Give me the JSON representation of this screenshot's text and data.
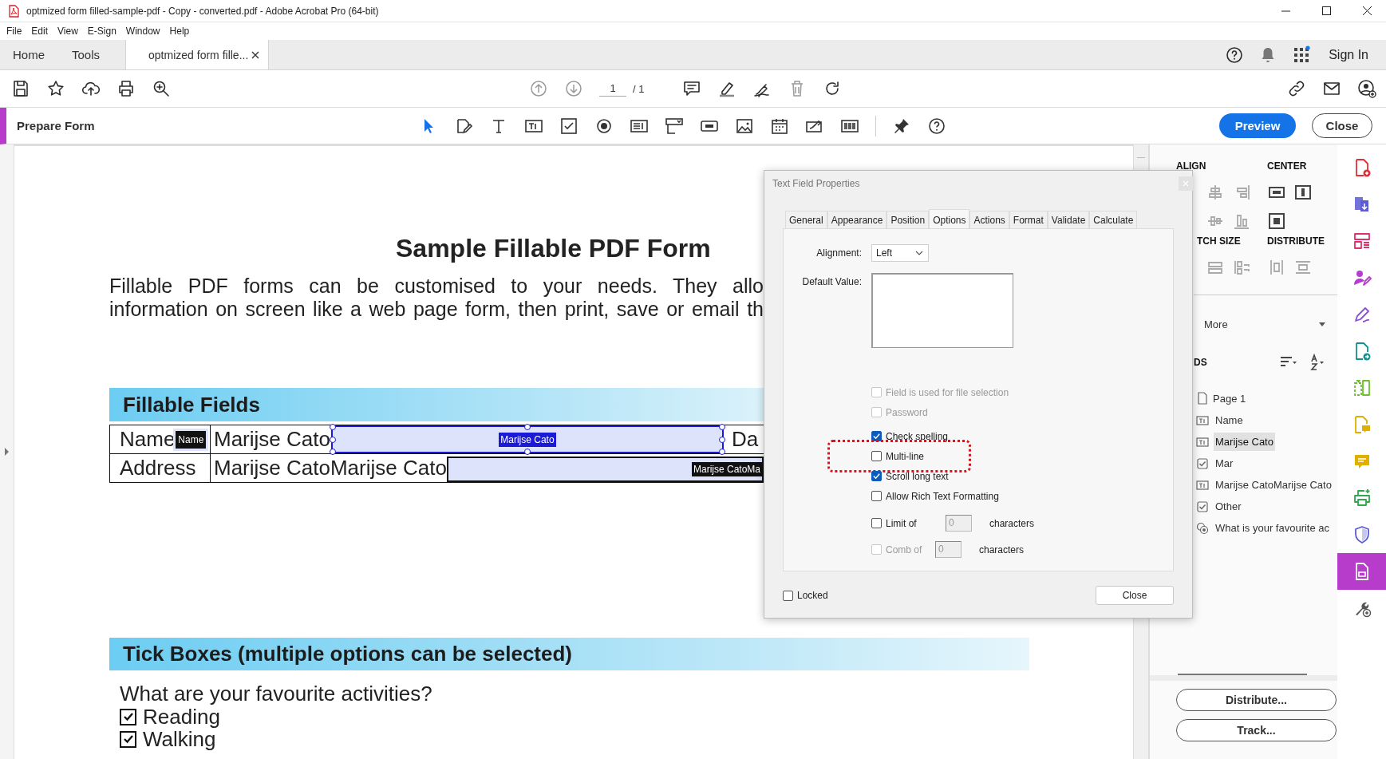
{
  "window": {
    "title": "optmized form filled-sample-pdf - Copy - converted.pdf - Adobe Acrobat Pro (64-bit)"
  },
  "menu": [
    "File",
    "Edit",
    "View",
    "E-Sign",
    "Window",
    "Help"
  ],
  "app_tabs": [
    {
      "label": "Home",
      "selected": false,
      "kind": "home"
    },
    {
      "label": "Tools",
      "selected": false,
      "kind": "home"
    },
    {
      "label": "optmized form fille...",
      "selected": true,
      "kind": "document"
    }
  ],
  "sign_in": "Sign In",
  "page_nav": {
    "current": "1",
    "total": "/ 1"
  },
  "prepare_form": {
    "title": "Prepare Form",
    "preview": "Preview",
    "close": "Close",
    "tools": [
      {
        "kind": "pointer",
        "selected": true
      },
      {
        "kind": "edit",
        "selected": false
      },
      {
        "kind": "text",
        "selected": false
      },
      {
        "kind": "text-field",
        "selected": false
      },
      {
        "kind": "checkbox",
        "selected": false
      },
      {
        "kind": "radio",
        "selected": false
      },
      {
        "kind": "list-box",
        "selected": false
      },
      {
        "kind": "dropdown",
        "selected": false
      },
      {
        "kind": "button",
        "selected": false
      },
      {
        "kind": "image",
        "selected": false
      },
      {
        "kind": "date",
        "selected": false
      },
      {
        "kind": "signature",
        "selected": false
      },
      {
        "kind": "barcode",
        "selected": false
      },
      {
        "kind": "pin",
        "selected": false
      },
      {
        "kind": "help",
        "selected": false
      }
    ]
  },
  "document": {
    "title": "Sample Fillable PDF Form",
    "intro": [
      "Fillable PDF forms can be customised to your needs. They allo",
      "information on screen like a web page form, then print, save or email th"
    ],
    "fillable": {
      "heading": "Fillable Fields",
      "rows": [
        {
          "label": "Name",
          "tag": "Name",
          "value": "Marijse Cato",
          "field_label": "Marijse Cato",
          "selected": true,
          "next": "Da"
        },
        {
          "label": "Address",
          "value": "Marijse CatoMarijse Cato",
          "field_label": "Marijse CatoMa",
          "selected": false
        }
      ]
    },
    "tick_boxes": {
      "heading": "Tick Boxes (multiple options can be selected)",
      "question": "What are your favourite activities?",
      "options": [
        {
          "label": "Reading",
          "checked": true
        },
        {
          "label": "Walking",
          "checked": true
        }
      ]
    }
  },
  "dialog": {
    "title": "Text Field Properties",
    "tabs": [
      {
        "label": "General",
        "selected": false
      },
      {
        "label": "Appearance",
        "selected": false
      },
      {
        "label": "Position",
        "selected": false
      },
      {
        "label": "Options",
        "selected": true
      },
      {
        "label": "Actions",
        "selected": false
      },
      {
        "label": "Format",
        "selected": false
      },
      {
        "label": "Validate",
        "selected": false
      },
      {
        "label": "Calculate",
        "selected": false
      }
    ],
    "alignment": {
      "label": "Alignment:",
      "value": "Left"
    },
    "default_value": {
      "label": "Default Value:"
    },
    "options": [
      {
        "label": "Field is used for file selection",
        "checked": false,
        "disabled": true,
        "highlighted": false
      },
      {
        "label": "Password",
        "checked": false,
        "disabled": true,
        "highlighted": false
      },
      {
        "label": "Check spelling",
        "checked": true,
        "disabled": false,
        "highlighted": false
      },
      {
        "label": "Multi-line",
        "checked": false,
        "disabled": false,
        "highlighted": true
      },
      {
        "label": "Scroll long text",
        "checked": true,
        "disabled": false,
        "highlighted": false
      },
      {
        "label": "Allow Rich Text Formatting",
        "checked": false,
        "disabled": false,
        "highlighted": false
      }
    ],
    "limits": [
      {
        "label": "Limit of",
        "checked": false,
        "disabled": false,
        "value": "0",
        "unit": "characters"
      },
      {
        "label": "Comb of",
        "checked": false,
        "disabled": true,
        "value": "0",
        "unit": "characters"
      }
    ],
    "locked": {
      "label": "Locked",
      "checked": false
    },
    "close": "Close"
  },
  "fields_panel": {
    "align": "ALIGN",
    "center": "CENTER",
    "match_size": "TCH SIZE",
    "distribute": "DISTRIBUTE",
    "more": "More",
    "fields_heading": "DS",
    "tree": [
      {
        "label": "Page 1",
        "kind": "page",
        "selected": false,
        "children": [
          {
            "label": "Name",
            "kind": "text",
            "selected": false
          },
          {
            "label": "Marijse Cato",
            "kind": "text",
            "selected": true
          },
          {
            "label": "Mar",
            "kind": "checkbox",
            "selected": false
          },
          {
            "label": "Marijse CatoMarijse Cato",
            "kind": "text",
            "selected": false
          },
          {
            "label": "Other",
            "kind": "checkbox",
            "selected": false
          },
          {
            "label": "What is your favourite ac",
            "kind": "radio",
            "selected": false
          }
        ]
      }
    ],
    "buttons": [
      "Distribute...",
      "Track..."
    ]
  },
  "rail": [
    {
      "kind": "create-pdf",
      "color": "#e0303a",
      "selected": false
    },
    {
      "kind": "export",
      "color": "#5b5bd6",
      "selected": false
    },
    {
      "kind": "organize",
      "color": "#e0306b",
      "selected": false
    },
    {
      "kind": "request-sign",
      "color": "#b63dd0",
      "selected": false
    },
    {
      "kind": "fill-sign",
      "color": "#8a4fd6",
      "selected": false
    },
    {
      "kind": "share",
      "color": "#14918c",
      "selected": false
    },
    {
      "kind": "compare",
      "color": "#6cc02f",
      "selected": false
    },
    {
      "kind": "comment-file",
      "color": "#e0b000",
      "selected": false
    },
    {
      "kind": "comment",
      "color": "#e0b000",
      "selected": false
    },
    {
      "kind": "print",
      "color": "#2ea84a",
      "selected": false
    },
    {
      "kind": "protect",
      "color": "#5b5bd6",
      "selected": false
    },
    {
      "kind": "form",
      "color": "#b83ccc",
      "selected": true
    },
    {
      "kind": "tools",
      "color": "#555555",
      "selected": false
    }
  ]
}
